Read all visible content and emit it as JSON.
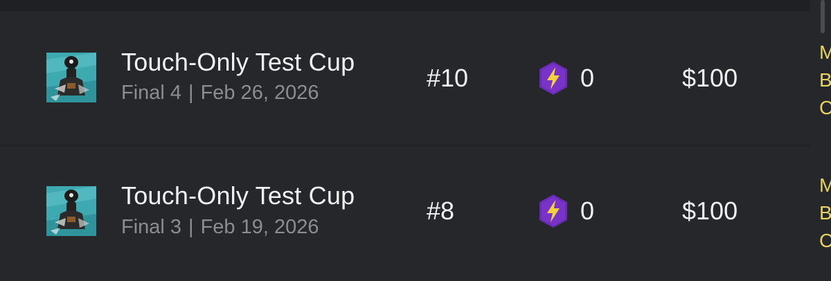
{
  "colors": {
    "background": "#25272b",
    "accent_purple": "#6a2bb5",
    "bolt_yellow": "#f2d43a",
    "side_text": "#e8d35c"
  },
  "rows": [
    {
      "thumbnail": "player-avatar",
      "title": "Touch-Only Test Cup",
      "stage": "Final 4",
      "separator": "|",
      "date": "Feb 26, 2026",
      "rank": "#10",
      "points_icon": "lightning-hexagon-icon",
      "points": "0",
      "prize": "$100",
      "side_letters": [
        "M",
        "B",
        "C"
      ]
    },
    {
      "thumbnail": "player-avatar",
      "title": "Touch-Only Test Cup",
      "stage": "Final 3",
      "separator": "|",
      "date": "Feb 19, 2026",
      "rank": "#8",
      "points_icon": "lightning-hexagon-icon",
      "points": "0",
      "prize": "$100",
      "side_letters": [
        "M",
        "B",
        "C"
      ]
    }
  ]
}
